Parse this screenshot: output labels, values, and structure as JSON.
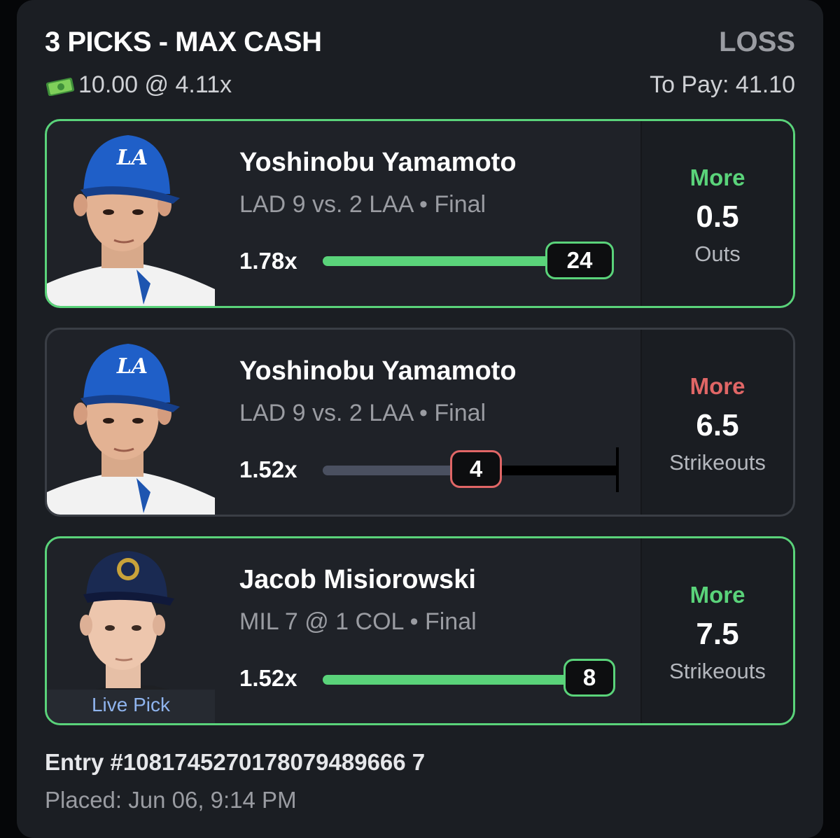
{
  "header": {
    "title": "3 PICKS - MAX CASH",
    "status": "LOSS",
    "wager": "10.00 @ 4.11x",
    "to_pay": "To Pay: 41.10"
  },
  "picks": [
    {
      "player": "Yoshinobu Yamamoto",
      "game": "LAD 9 vs. 2 LAA • Final",
      "multiplier": "1.78x",
      "actual": "24",
      "direction": "More",
      "line": "0.5",
      "stat": "Outs",
      "result": "win",
      "team_logo": "LA",
      "progress": 1.0
    },
    {
      "player": "Yoshinobu Yamamoto",
      "game": "LAD 9 vs. 2 LAA • Final",
      "multiplier": "1.52x",
      "actual": "4",
      "direction": "More",
      "line": "6.5",
      "stat": "Strikeouts",
      "result": "loss",
      "team_logo": "LA",
      "progress": 0.62
    },
    {
      "player": "Jacob Misiorowski",
      "game": "MIL 7 @ 1 COL • Final",
      "multiplier": "1.52x",
      "actual": "8",
      "direction": "More",
      "line": "7.5",
      "stat": "Strikeouts",
      "result": "win",
      "live_label": "Live Pick",
      "progress": 1.0
    }
  ],
  "footer": {
    "entry": "Entry #1081745270178079489666 7",
    "placed": "Placed: Jun 06, 9:14 PM"
  },
  "colors": {
    "win": "#5ad37a",
    "loss": "#e06666",
    "background": "#1b1e23"
  }
}
